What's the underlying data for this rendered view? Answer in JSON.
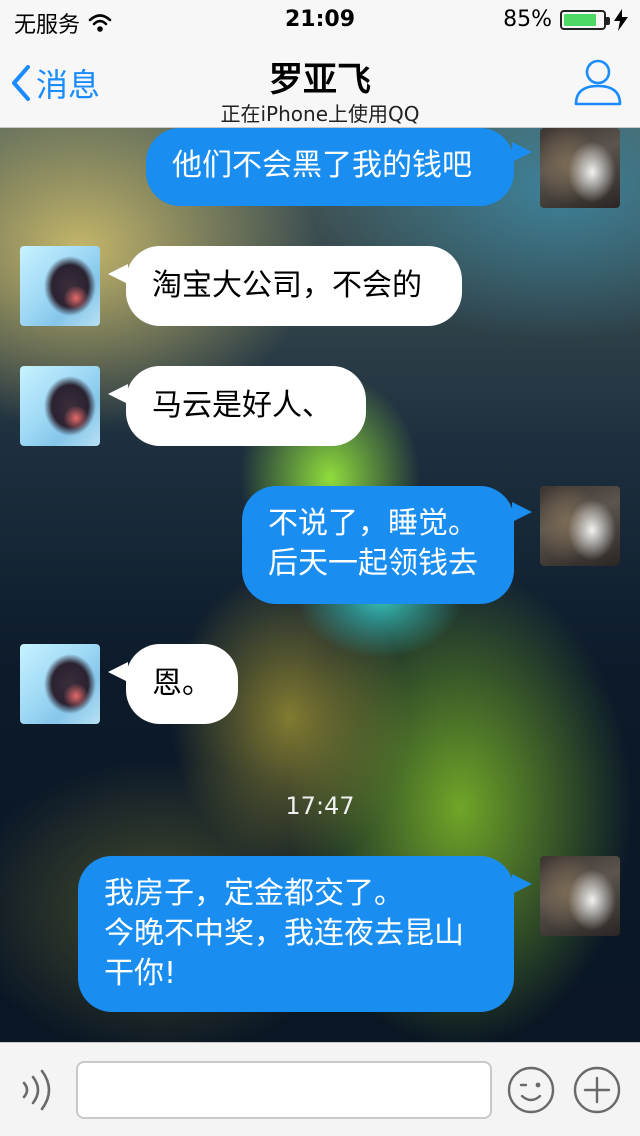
{
  "status_bar": {
    "carrier": "无服务",
    "time": "21:09",
    "battery_percent_text": "85%",
    "battery_level": 0.85
  },
  "nav": {
    "back_label": "消息",
    "title": "罗亚飞",
    "subtitle": "正在iPhone上使用QQ"
  },
  "messages": [
    {
      "sender": "me",
      "text": "他们不会黑了我的钱吧"
    },
    {
      "sender": "other",
      "text": "淘宝大公司，不会的"
    },
    {
      "sender": "other",
      "text": "马云是好人、"
    },
    {
      "sender": "me",
      "lines": [
        "不说了，睡觉。",
        "后天一起领钱去"
      ]
    },
    {
      "sender": "other",
      "text": "恩。"
    },
    {
      "timestamp": "17:47"
    },
    {
      "sender": "me",
      "lines": [
        "我房子，定金都交了。",
        "今晚不中奖，我连夜去昆山",
        "干你!"
      ]
    }
  ],
  "input_bar": {
    "placeholder": ""
  },
  "icons": {
    "wifi": "wifi-icon",
    "back": "chevron-left-icon",
    "profile": "person-icon",
    "voice": "voice-icon",
    "emoji": "emoji-icon",
    "plus": "plus-icon"
  },
  "colors": {
    "accent": "#1a8cff",
    "outgoing_bubble": "#1a8ef0",
    "incoming_bubble": "#ffffff",
    "battery": "#4cd964"
  }
}
